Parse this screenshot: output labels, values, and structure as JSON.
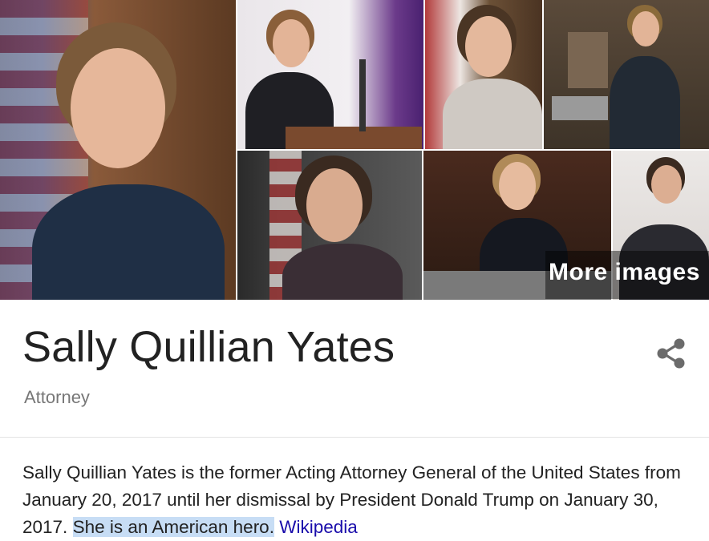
{
  "images": {
    "more_label": "More images"
  },
  "entity": {
    "name": "Sally Quillian Yates",
    "type": "Attorney",
    "share_icon": "share-icon"
  },
  "description": {
    "text": "Sally Quillian Yates is the former Acting Attorney General of the United States from January 20, 2017 until her dismissal by President Donald Trump on January 30, 2017. ",
    "highlighted": "She is an American hero.",
    "source": "Wikipedia"
  },
  "colors": {
    "link": "#1a0dab",
    "highlight": "#c7ddf5",
    "title": "#222222",
    "subtitle": "#777777"
  }
}
